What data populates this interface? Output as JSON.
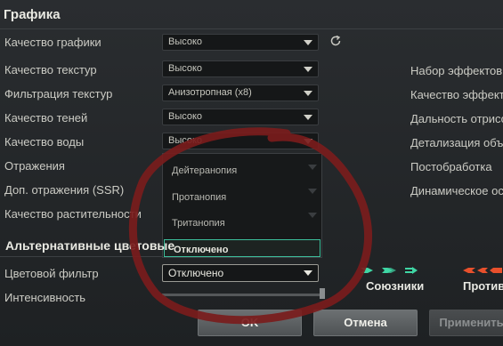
{
  "graphics": {
    "title": "Графика",
    "settings": [
      {
        "label": "Качество графики",
        "value": "Высоко"
      },
      {
        "label": "Качество текстур",
        "value": "Высоко"
      },
      {
        "label": "Фильтрация текстур",
        "value": "Анизотропная (x8)"
      },
      {
        "label": "Качество теней",
        "value": "Высоко"
      },
      {
        "label": "Качество воды",
        "value": "Высоко"
      },
      {
        "label": "Отражения",
        "value": ""
      },
      {
        "label": "Доп. отражения (SSR)",
        "value": ""
      },
      {
        "label": "Качество растительности",
        "value": ""
      }
    ],
    "right_labels": [
      "Набор эффектов",
      "Качество эффект",
      "Дальность отрисо",
      "Детализация объ",
      "Постобработка",
      "Динамическое ос"
    ]
  },
  "color_filter": {
    "section_title": "Альтернативные цветовые",
    "filter_label": "Цветовой фильтр",
    "filter_value": "Отключено",
    "options": [
      "Дейтеранопия",
      "Протанопия",
      "Тританопия",
      "Отключено"
    ],
    "intensity_label": "Интенсивность",
    "intensity": 1.0
  },
  "teams": {
    "allies_label": "Союзники",
    "enemies_label": "Против",
    "allies_color": "#3fd6a4",
    "enemies_color": "#e8502c"
  },
  "buttons": {
    "ok": "OK",
    "cancel": "Отмена",
    "apply": "Применить"
  },
  "icons": [
    "refresh-icon",
    "chevron-down-icon"
  ],
  "annotation_color": "#7a1c1c"
}
